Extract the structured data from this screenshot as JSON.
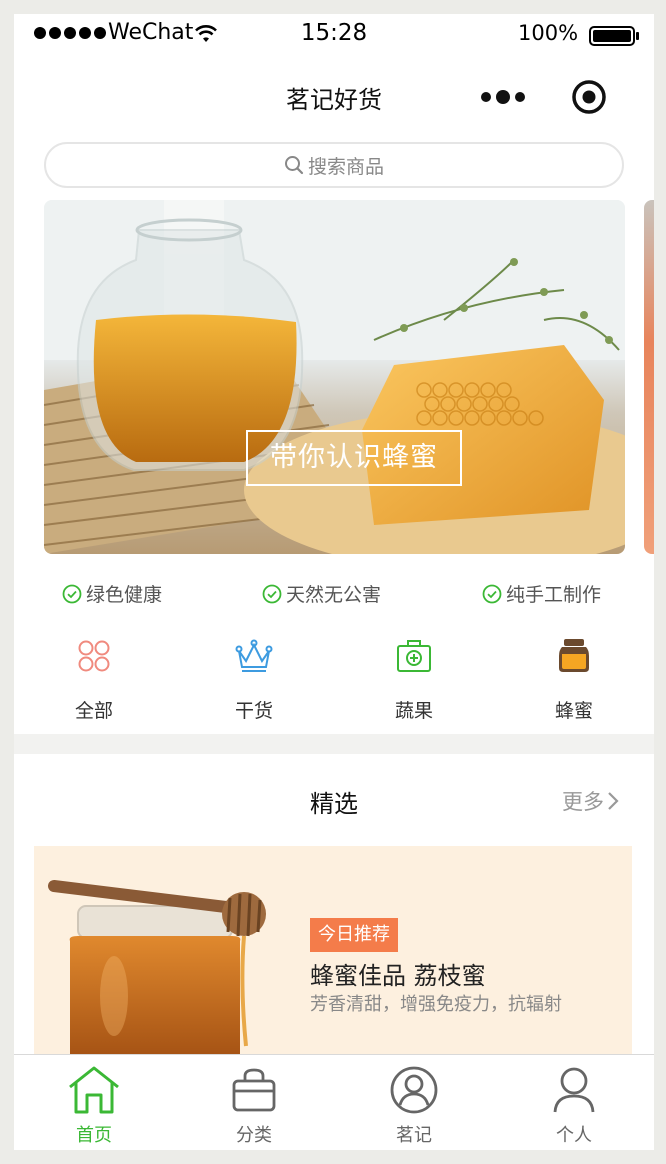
{
  "status_bar": {
    "carrier": "WeChat",
    "time": "15:28",
    "battery": "100%"
  },
  "navbar": {
    "title": "茗记好货"
  },
  "search": {
    "placeholder": "搜索商品"
  },
  "banner": {
    "caption": "带你认识蜂蜜"
  },
  "features": [
    {
      "label": "绿色健康"
    },
    {
      "label": "天然无公害"
    },
    {
      "label": "纯手工制作"
    }
  ],
  "categories": [
    {
      "label": "全部",
      "icon": "grid-icon"
    },
    {
      "label": "干货",
      "icon": "crown-icon"
    },
    {
      "label": "蔬果",
      "icon": "medical-box-icon"
    },
    {
      "label": "蜂蜜",
      "icon": "honey-jar-icon"
    }
  ],
  "featured": {
    "title": "精选",
    "more": "更多",
    "card": {
      "badge": "今日推荐",
      "title": "蜂蜜佳品 荔枝蜜",
      "desc": "芳香清甜，增强免疫力，抗辐射"
    }
  },
  "tabbar": [
    {
      "label": "首页",
      "icon": "home-icon",
      "active": true
    },
    {
      "label": "分类",
      "icon": "bag-icon",
      "active": false
    },
    {
      "label": "茗记",
      "icon": "user-circle-icon",
      "active": false
    },
    {
      "label": "个人",
      "icon": "person-icon",
      "active": false
    }
  ],
  "colors": {
    "accent_green": "#3bb835",
    "badge_orange": "#f47c4a",
    "card_bg": "#fdf0df"
  }
}
